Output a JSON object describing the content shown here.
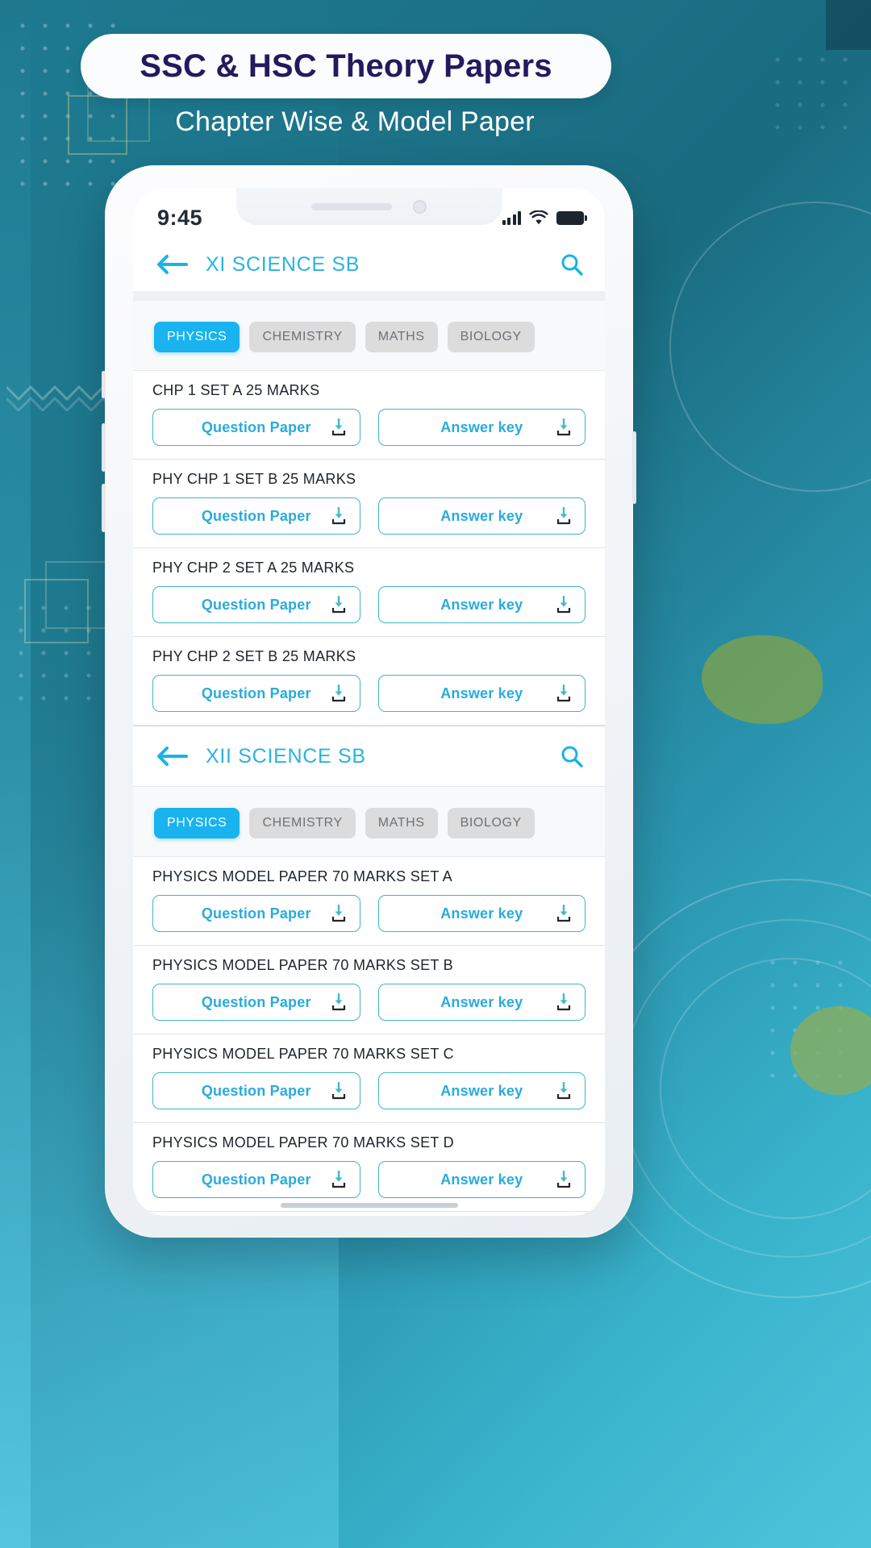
{
  "promo": {
    "title": "SSC & HSC Theory Papers",
    "subtitle": "Chapter Wise & Model Paper"
  },
  "colors": {
    "accent_blue": "#19b3f0",
    "link_blue": "#29abdc",
    "button_border": "#3db5c9",
    "title_navy": "#211b5e",
    "bg_teal": "#1d7a91"
  },
  "phone": {
    "status_bar": {
      "time": "9:45",
      "signal_icon": "signal-bars-icon",
      "wifi_icon": "wifi-icon",
      "battery_icon": "battery-full-icon"
    },
    "home_indicator": "home-indicator"
  },
  "sections": [
    {
      "header": {
        "back_icon": "back-arrow-icon",
        "title": "XI SCIENCE SB",
        "search_icon": "search-icon"
      },
      "tabs": [
        {
          "label": "PHYSICS",
          "active": true
        },
        {
          "label": "CHEMISTRY",
          "active": false
        },
        {
          "label": "MATHS",
          "active": false
        },
        {
          "label": "BIOLOGY",
          "active": false
        }
      ],
      "rows": [
        {
          "title": "CHP 1 SET A  25 MARKS",
          "question_label": "Question Paper",
          "answer_label": "Answer key"
        },
        {
          "title": "PHY CHP 1 SET B 25 MARKS",
          "question_label": "Question Paper",
          "answer_label": "Answer key"
        },
        {
          "title": "PHY CHP 2 SET A 25 MARKS",
          "question_label": "Question Paper",
          "answer_label": "Answer key"
        },
        {
          "title": "PHY CHP 2 SET B 25 MARKS",
          "question_label": "Question Paper",
          "answer_label": "Answer key"
        }
      ]
    },
    {
      "header": {
        "back_icon": "back-arrow-icon",
        "title": "XII SCIENCE SB",
        "search_icon": "search-icon"
      },
      "tabs": [
        {
          "label": "PHYSICS",
          "active": true
        },
        {
          "label": "CHEMISTRY",
          "active": false
        },
        {
          "label": "MATHS",
          "active": false
        },
        {
          "label": "BIOLOGY",
          "active": false
        }
      ],
      "rows": [
        {
          "title": "PHYSICS MODEL PAPER 70 MARKS SET A",
          "question_label": "Question Paper",
          "answer_label": "Answer key"
        },
        {
          "title": "PHYSICS MODEL PAPER 70 MARKS SET B",
          "question_label": "Question Paper",
          "answer_label": "Answer key"
        },
        {
          "title": "PHYSICS MODEL PAPER 70 MARKS SET C",
          "question_label": "Question Paper",
          "answer_label": "Answer key"
        },
        {
          "title": "PHYSICS MODEL PAPER 70 MARKS SET D",
          "question_label": "Question Paper",
          "answer_label": "Answer key"
        }
      ]
    }
  ]
}
